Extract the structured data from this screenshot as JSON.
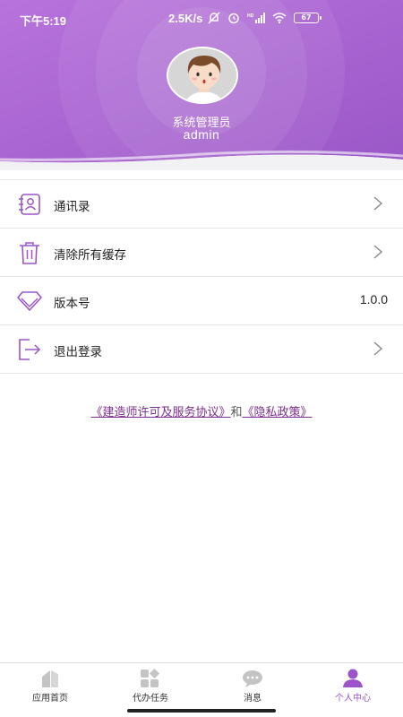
{
  "status_bar": {
    "time": "下午5:19",
    "network_speed": "2.5K/s",
    "battery_level": "67",
    "icons": [
      "mute-bell-icon",
      "alarm-icon",
      "hd-signal-icon",
      "wifi-icon",
      "battery-icon"
    ]
  },
  "profile": {
    "role": "系统管理员",
    "username": "admin"
  },
  "menu": {
    "items": [
      {
        "label": "通讯录",
        "icon": "contacts-icon",
        "type": "link"
      },
      {
        "label": "清除所有缓存",
        "icon": "trash-icon",
        "type": "link"
      },
      {
        "label": "版本号",
        "icon": "diamond-icon",
        "type": "value",
        "value": "1.0.0"
      },
      {
        "label": "退出登录",
        "icon": "logout-icon",
        "type": "link"
      }
    ]
  },
  "agreement": {
    "license_link": "《建造师许可及服务协议》",
    "connector": "和",
    "privacy_link": "《隐私政策》"
  },
  "tabbar": {
    "tabs": [
      {
        "label": "应用首页",
        "icon": "home-icon",
        "active": false
      },
      {
        "label": "代办任务",
        "icon": "tasks-icon",
        "active": false
      },
      {
        "label": "消息",
        "icon": "message-icon",
        "active": false
      },
      {
        "label": "个人中心",
        "icon": "user-icon",
        "active": true
      }
    ]
  },
  "colors": {
    "accent": "#9b55c9",
    "header_gradient_start": "#b06cd6",
    "header_gradient_end": "#9a59c8",
    "link": "#7b2d8e"
  }
}
